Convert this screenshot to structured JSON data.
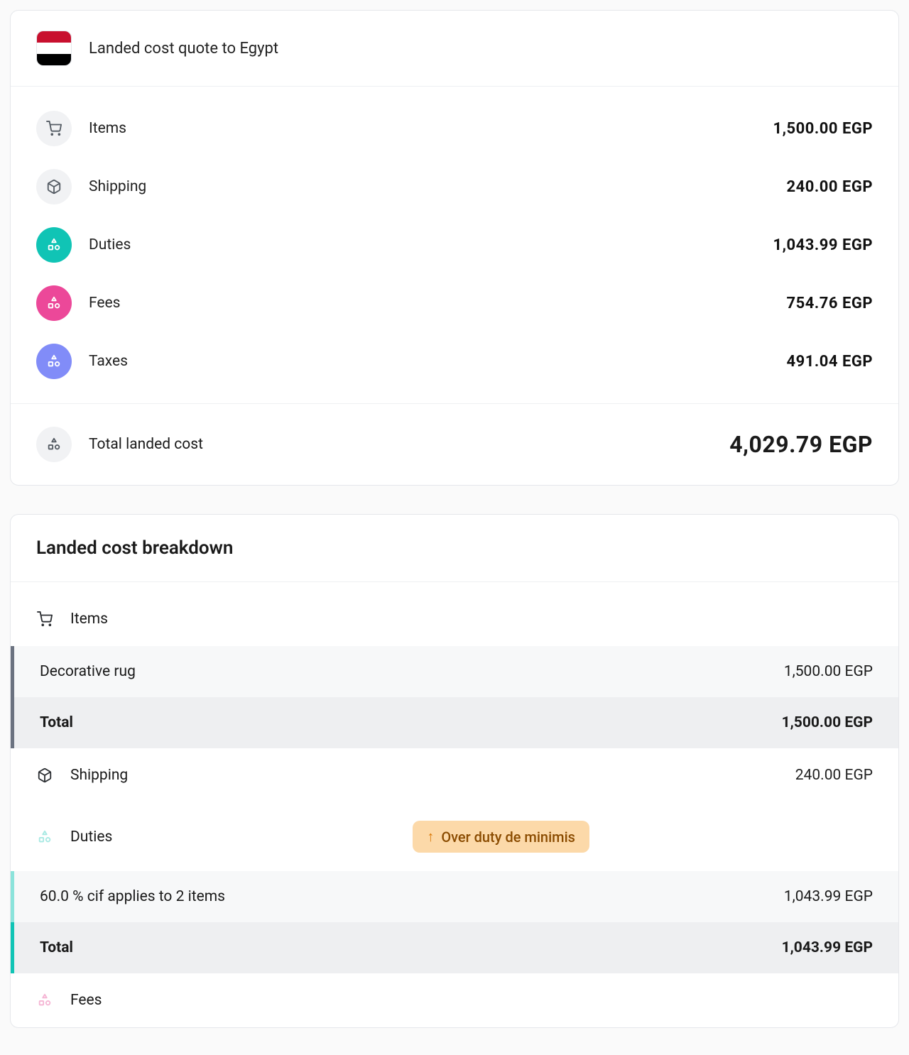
{
  "quote": {
    "title": "Landed cost quote to Egypt",
    "rows": [
      {
        "label": "Items",
        "value": "1,500.00 EGP"
      },
      {
        "label": "Shipping",
        "value": "240.00 EGP"
      },
      {
        "label": "Duties",
        "value": "1,043.99 EGP"
      },
      {
        "label": "Fees",
        "value": "754.76 EGP"
      },
      {
        "label": "Taxes",
        "value": "491.04 EGP"
      }
    ],
    "total_label": "Total landed cost",
    "total_value": "4,029.79 EGP"
  },
  "breakdown": {
    "title": "Landed cost breakdown",
    "items_section_label": "Items",
    "items": [
      {
        "name": "Decorative rug",
        "value": "1,500.00 EGP"
      }
    ],
    "items_total_label": "Total",
    "items_total_value": "1,500.00 EGP",
    "shipping_label": "Shipping",
    "shipping_value": "240.00 EGP",
    "duties_label": "Duties",
    "duties_badge": "Over duty de minimis",
    "duties_line_label": "60.0 % cif applies to 2 items",
    "duties_line_value": "1,043.99 EGP",
    "duties_total_label": "Total",
    "duties_total_value": "1,043.99 EGP",
    "fees_label": "Fees"
  }
}
